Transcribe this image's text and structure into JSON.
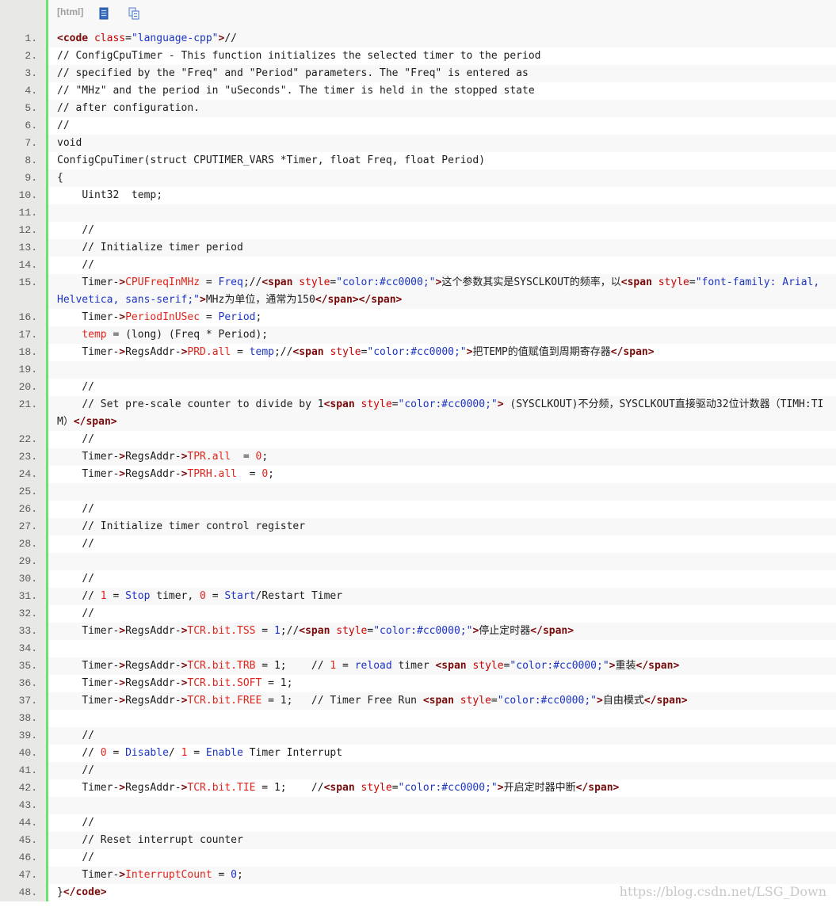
{
  "toolbar": {
    "label": "[html]",
    "view_icon": "view-source-icon",
    "copy_icon": "copy-icon"
  },
  "watermark": "https://blog.csdn.net/LSG_Down",
  "colors": {
    "gutter_bg": "#e8e8e4",
    "gutter_line": "#6ce26c",
    "tag": "#7a0a0a",
    "attr": "#cc0000",
    "string": "#1c34c4"
  },
  "lines": [
    {
      "n": "1.",
      "t": [
        [
          "kw",
          "<code "
        ],
        [
          "attr",
          "class"
        ],
        [
          "",
          "="
        ],
        [
          "str",
          "\"language-cpp\""
        ],
        [
          "kw",
          ">"
        ],
        [
          "",
          "//"
        ]
      ]
    },
    {
      "n": "2.",
      "t": [
        [
          "",
          "// ConfigCpuTimer - This function initializes the selected timer to the period"
        ]
      ]
    },
    {
      "n": "3.",
      "t": [
        [
          "",
          "// specified by the \"Freq\" and \"Period\" parameters. The \"Freq\" is entered as"
        ]
      ]
    },
    {
      "n": "4.",
      "t": [
        [
          "",
          "// \"MHz\" and the period in \"uSeconds\". The timer is held in the stopped state"
        ]
      ]
    },
    {
      "n": "5.",
      "t": [
        [
          "",
          "// after configuration."
        ]
      ]
    },
    {
      "n": "6.",
      "t": [
        [
          "",
          "//"
        ]
      ]
    },
    {
      "n": "7.",
      "t": [
        [
          "",
          "void"
        ]
      ]
    },
    {
      "n": "8.",
      "t": [
        [
          "",
          "ConfigCpuTimer(struct CPUTIMER_VARS *Timer, float Freq, float Period)"
        ]
      ]
    },
    {
      "n": "9.",
      "t": [
        [
          "",
          "{"
        ]
      ]
    },
    {
      "n": "10.",
      "t": [
        [
          "",
          "    Uint32  temp;"
        ]
      ]
    },
    {
      "n": "11.",
      "t": [
        [
          "",
          ""
        ]
      ]
    },
    {
      "n": "12.",
      "t": [
        [
          "",
          "    //"
        ]
      ]
    },
    {
      "n": "13.",
      "t": [
        [
          "",
          "    // Initialize timer period"
        ]
      ]
    },
    {
      "n": "14.",
      "t": [
        [
          "",
          "    //"
        ]
      ]
    },
    {
      "n": "15.",
      "t": [
        [
          "",
          "    Timer-"
        ],
        [
          "kw",
          ">"
        ],
        [
          "tok-red",
          "CPUFreqInMHz"
        ],
        [
          "",
          " = "
        ],
        [
          "tok-blue",
          "Freq"
        ],
        [
          "",
          ";//"
        ],
        [
          "kw",
          "<span "
        ],
        [
          "attr",
          "style"
        ],
        [
          "",
          "="
        ],
        [
          "str",
          "\"color:#cc0000;\""
        ],
        [
          "kw",
          ">"
        ],
        [
          "",
          "这个参数其实是SYSCLKOUT的频率，以"
        ],
        [
          "kw",
          "<span "
        ],
        [
          "attr",
          "style"
        ],
        [
          "",
          "="
        ],
        [
          "str",
          "\"font-family: Arial, Helvetica, sans-serif;\""
        ],
        [
          "kw",
          ">"
        ],
        [
          "",
          "MHz为单位，通常为150"
        ],
        [
          "kw",
          "</span></span>"
        ]
      ]
    },
    {
      "n": "16.",
      "t": [
        [
          "",
          "    Timer-"
        ],
        [
          "kw",
          ">"
        ],
        [
          "tok-red",
          "PeriodInUSec"
        ],
        [
          "",
          " = "
        ],
        [
          "tok-blue",
          "Period"
        ],
        [
          "",
          ";"
        ]
      ]
    },
    {
      "n": "17.",
      "t": [
        [
          "",
          "    "
        ],
        [
          "tok-red",
          "temp"
        ],
        [
          "",
          " = (long) (Freq * Period);"
        ]
      ]
    },
    {
      "n": "18.",
      "t": [
        [
          "",
          "    Timer-"
        ],
        [
          "kw",
          ">"
        ],
        [
          "",
          "RegsAddr-"
        ],
        [
          "kw",
          ">"
        ],
        [
          "tok-red",
          "PRD.all"
        ],
        [
          "",
          " = "
        ],
        [
          "tok-blue",
          "temp"
        ],
        [
          "",
          ";//"
        ],
        [
          "kw",
          "<span "
        ],
        [
          "attr",
          "style"
        ],
        [
          "",
          "="
        ],
        [
          "str",
          "\"color:#cc0000;\""
        ],
        [
          "kw",
          ">"
        ],
        [
          "",
          "把TEMP的值赋值到周期寄存器"
        ],
        [
          "kw",
          "</span>"
        ]
      ]
    },
    {
      "n": "19.",
      "t": [
        [
          "",
          ""
        ]
      ]
    },
    {
      "n": "20.",
      "t": [
        [
          "",
          "    //"
        ]
      ]
    },
    {
      "n": "21.",
      "t": [
        [
          "",
          "    // Set pre-scale counter to divide by 1"
        ],
        [
          "kw",
          "<span "
        ],
        [
          "attr",
          "style"
        ],
        [
          "",
          "="
        ],
        [
          "str",
          "\"color:#cc0000;\""
        ],
        [
          "kw",
          ">"
        ],
        [
          "",
          " (SYSCLKOUT)不分频，SYSCLKOUT直接驱动32位计数器（TIMH:TIM）"
        ],
        [
          "kw",
          "</span>"
        ]
      ]
    },
    {
      "n": "22.",
      "t": [
        [
          "",
          "    //"
        ]
      ]
    },
    {
      "n": "23.",
      "t": [
        [
          "",
          "    Timer-"
        ],
        [
          "kw",
          ">"
        ],
        [
          "",
          "RegsAddr-"
        ],
        [
          "kw",
          ">"
        ],
        [
          "tok-red",
          "TPR.all"
        ],
        [
          "",
          "  = "
        ],
        [
          "tok-red",
          "0"
        ],
        [
          "",
          ";"
        ]
      ]
    },
    {
      "n": "24.",
      "t": [
        [
          "",
          "    Timer-"
        ],
        [
          "kw",
          ">"
        ],
        [
          "",
          "RegsAddr-"
        ],
        [
          "kw",
          ">"
        ],
        [
          "tok-red",
          "TPRH.all"
        ],
        [
          "",
          "  = "
        ],
        [
          "tok-red",
          "0"
        ],
        [
          "",
          ";"
        ]
      ]
    },
    {
      "n": "25.",
      "t": [
        [
          "",
          ""
        ]
      ]
    },
    {
      "n": "26.",
      "t": [
        [
          "",
          "    //"
        ]
      ]
    },
    {
      "n": "27.",
      "t": [
        [
          "",
          "    // Initialize timer control register"
        ]
      ]
    },
    {
      "n": "28.",
      "t": [
        [
          "",
          "    //"
        ]
      ]
    },
    {
      "n": "29.",
      "t": [
        [
          "",
          ""
        ]
      ]
    },
    {
      "n": "30.",
      "t": [
        [
          "",
          "    //"
        ]
      ]
    },
    {
      "n": "31.",
      "t": [
        [
          "",
          "    // "
        ],
        [
          "tok-red",
          "1"
        ],
        [
          "",
          " = "
        ],
        [
          "tok-blue",
          "Stop"
        ],
        [
          "",
          " timer, "
        ],
        [
          "tok-red",
          "0"
        ],
        [
          "",
          " = "
        ],
        [
          "tok-blue",
          "Start"
        ],
        [
          "",
          "/Restart Timer"
        ]
      ]
    },
    {
      "n": "32.",
      "t": [
        [
          "",
          "    //"
        ]
      ]
    },
    {
      "n": "33.",
      "t": [
        [
          "",
          "    Timer-"
        ],
        [
          "kw",
          ">"
        ],
        [
          "",
          "RegsAddr-"
        ],
        [
          "kw",
          ">"
        ],
        [
          "tok-red",
          "TCR.bit.TSS"
        ],
        [
          "",
          " = "
        ],
        [
          "tok-blue",
          "1"
        ],
        [
          "",
          ";//"
        ],
        [
          "kw",
          "<span "
        ],
        [
          "attr",
          "style"
        ],
        [
          "",
          "="
        ],
        [
          "str",
          "\"color:#cc0000;\""
        ],
        [
          "kw",
          ">"
        ],
        [
          "",
          "停止定时器"
        ],
        [
          "kw",
          "</span>"
        ]
      ]
    },
    {
      "n": "34.",
      "t": [
        [
          "",
          ""
        ]
      ]
    },
    {
      "n": "35.",
      "t": [
        [
          "",
          "    Timer-"
        ],
        [
          "kw",
          ">"
        ],
        [
          "",
          "RegsAddr-"
        ],
        [
          "kw",
          ">"
        ],
        [
          "tok-red",
          "TCR.bit.TRB"
        ],
        [
          "",
          " = 1;    // "
        ],
        [
          "tok-red",
          "1"
        ],
        [
          "",
          " = "
        ],
        [
          "tok-blue",
          "reload"
        ],
        [
          "",
          " timer "
        ],
        [
          "kw",
          "<span "
        ],
        [
          "attr",
          "style"
        ],
        [
          "",
          "="
        ],
        [
          "str",
          "\"color:#cc0000;\""
        ],
        [
          "kw",
          ">"
        ],
        [
          "",
          "重装"
        ],
        [
          "kw",
          "</span>"
        ]
      ]
    },
    {
      "n": "36.",
      "t": [
        [
          "",
          "    Timer-"
        ],
        [
          "kw",
          ">"
        ],
        [
          "",
          "RegsAddr-"
        ],
        [
          "kw",
          ">"
        ],
        [
          "tok-red",
          "TCR.bit.SOFT"
        ],
        [
          "",
          " = 1;"
        ]
      ]
    },
    {
      "n": "37.",
      "t": [
        [
          "",
          "    Timer-"
        ],
        [
          "kw",
          ">"
        ],
        [
          "",
          "RegsAddr-"
        ],
        [
          "kw",
          ">"
        ],
        [
          "tok-red",
          "TCR.bit.FREE"
        ],
        [
          "",
          " = 1;   // Timer Free Run "
        ],
        [
          "kw",
          "<span "
        ],
        [
          "attr",
          "style"
        ],
        [
          "",
          "="
        ],
        [
          "str",
          "\"color:#cc0000;\""
        ],
        [
          "kw",
          ">"
        ],
        [
          "",
          "自由模式"
        ],
        [
          "kw",
          "</span>"
        ]
      ]
    },
    {
      "n": "38.",
      "t": [
        [
          "",
          ""
        ]
      ]
    },
    {
      "n": "39.",
      "t": [
        [
          "",
          "    //"
        ]
      ]
    },
    {
      "n": "40.",
      "t": [
        [
          "",
          "    // "
        ],
        [
          "tok-red",
          "0"
        ],
        [
          "",
          " = "
        ],
        [
          "tok-blue",
          "Disable"
        ],
        [
          "",
          "/ "
        ],
        [
          "tok-red",
          "1"
        ],
        [
          "",
          " = "
        ],
        [
          "tok-blue",
          "Enable"
        ],
        [
          "",
          " Timer Interrupt"
        ]
      ]
    },
    {
      "n": "41.",
      "t": [
        [
          "",
          "    //"
        ]
      ]
    },
    {
      "n": "42.",
      "t": [
        [
          "",
          "    Timer-"
        ],
        [
          "kw",
          ">"
        ],
        [
          "",
          "RegsAddr-"
        ],
        [
          "kw",
          ">"
        ],
        [
          "tok-red",
          "TCR.bit.TIE"
        ],
        [
          "",
          " = 1;    //"
        ],
        [
          "kw",
          "<span "
        ],
        [
          "attr",
          "style"
        ],
        [
          "",
          "="
        ],
        [
          "str",
          "\"color:#cc0000;\""
        ],
        [
          "kw",
          ">"
        ],
        [
          "",
          "开启定时器中断"
        ],
        [
          "kw",
          "</span>"
        ]
      ]
    },
    {
      "n": "43.",
      "t": [
        [
          "",
          ""
        ]
      ]
    },
    {
      "n": "44.",
      "t": [
        [
          "",
          "    //"
        ]
      ]
    },
    {
      "n": "45.",
      "t": [
        [
          "",
          "    // Reset interrupt counter"
        ]
      ]
    },
    {
      "n": "46.",
      "t": [
        [
          "",
          "    //"
        ]
      ]
    },
    {
      "n": "47.",
      "t": [
        [
          "",
          "    Timer-"
        ],
        [
          "kw",
          ">"
        ],
        [
          "tok-red",
          "InterruptCount"
        ],
        [
          "",
          " = "
        ],
        [
          "tok-blue",
          "0"
        ],
        [
          "",
          ";"
        ]
      ]
    },
    {
      "n": "48.",
      "t": [
        [
          "",
          "}"
        ],
        [
          "kw",
          "</code>"
        ]
      ]
    }
  ]
}
